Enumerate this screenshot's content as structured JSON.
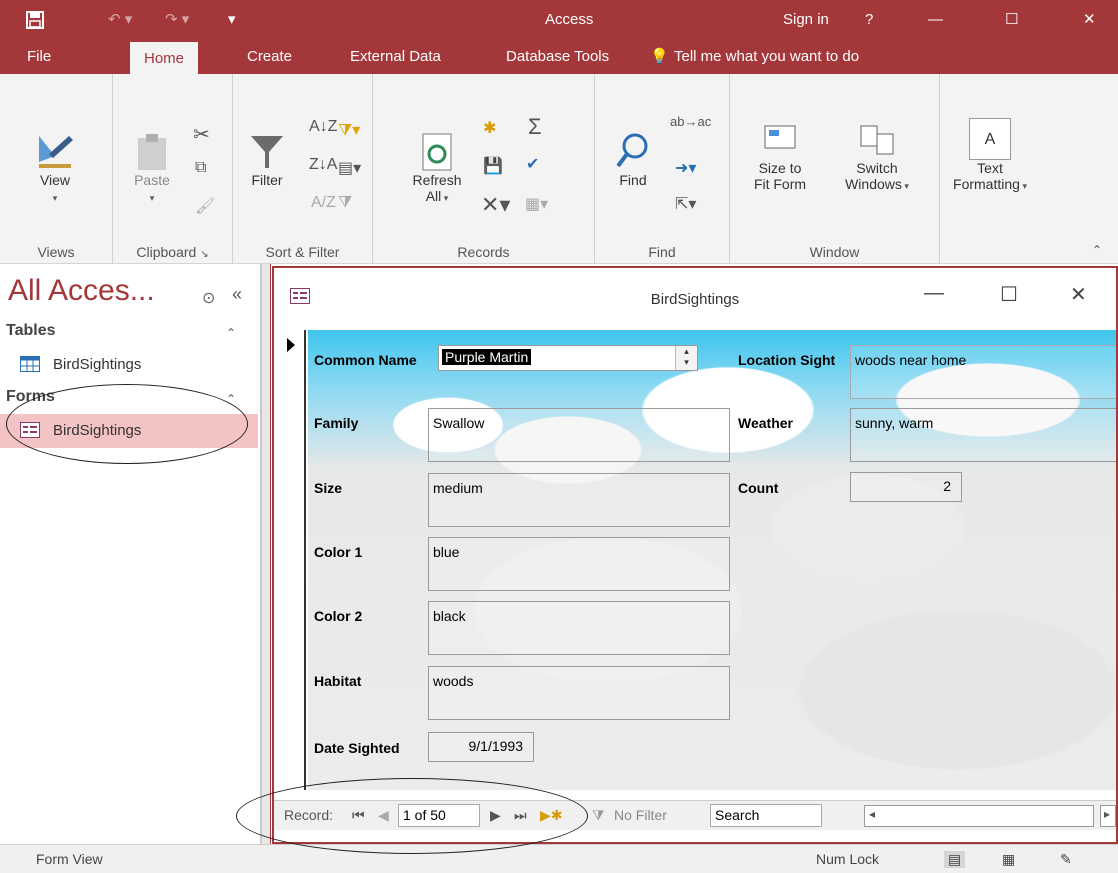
{
  "titlebar": {
    "app_title": "Access",
    "sign_in": "Sign in",
    "help": "?",
    "minimize": "—",
    "maximize": "☐",
    "close": "✕"
  },
  "tabs": {
    "file": "File",
    "home": "Home",
    "create": "Create",
    "external_data": "External Data",
    "database_tools": "Database Tools",
    "tell_me": "Tell me what you want to do"
  },
  "ribbon": {
    "view": "View",
    "paste": "Paste",
    "filter": "Filter",
    "refresh_all": "Refresh",
    "refresh_all2": "All",
    "find": "Find",
    "size_to_fit": "Size to",
    "size_to_fit2": "Fit Form",
    "switch_windows": "Switch",
    "switch_windows2": "Windows",
    "text_formatting": "Text",
    "text_formatting2": "Formatting",
    "groups": {
      "views": "Views",
      "clipboard": "Clipboard",
      "sort_filter": "Sort & Filter",
      "records": "Records",
      "find": "Find",
      "window": "Window"
    }
  },
  "nav": {
    "title": "All Acces...",
    "tables_header": "Tables",
    "tables_item": "BirdSightings",
    "forms_header": "Forms",
    "forms_item": "BirdSightings"
  },
  "form": {
    "title": "BirdSightings",
    "labels": {
      "common_name": "Common Name",
      "family": "Family",
      "size": "Size",
      "color1": "Color 1",
      "color2": "Color 2",
      "habitat": "Habitat",
      "date_sighted": "Date Sighted",
      "location_sighted": "Location Sight",
      "weather": "Weather",
      "count": "Count"
    },
    "values": {
      "common_name": "Purple Martin",
      "family": "Swallow",
      "size": "medium",
      "color1": "blue",
      "color2": "black",
      "habitat": "woods",
      "date_sighted": "9/1/1993",
      "location_sighted": "woods near home",
      "weather": "sunny, warm",
      "count": "2"
    }
  },
  "recordnav": {
    "record_label": "Record:",
    "position": "1 of 50",
    "no_filter": "No Filter",
    "search": "Search"
  },
  "status": {
    "view": "Form View",
    "num_lock": "Num Lock"
  },
  "colors": {
    "accent": "#a4373a",
    "nav_selected": "#f4c4c4",
    "sky": "#3fc5ee"
  }
}
